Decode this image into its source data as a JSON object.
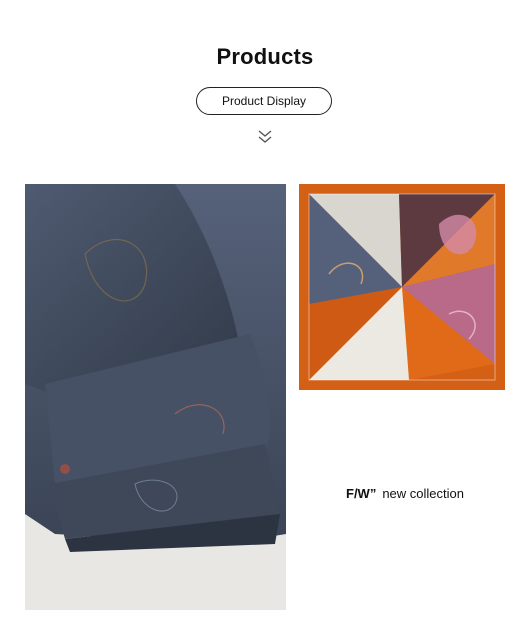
{
  "header": {
    "title": "Products",
    "button_label": "Product Display"
  },
  "icons": {
    "scroll_hint": "double-chevron-down-icon"
  },
  "caption": {
    "brand": "F/W”",
    "text": "new collection"
  },
  "colors": {
    "fabric_navy": "#4a5566",
    "accent_orange": "#d46016",
    "accent_pink": "#c06a8a"
  }
}
